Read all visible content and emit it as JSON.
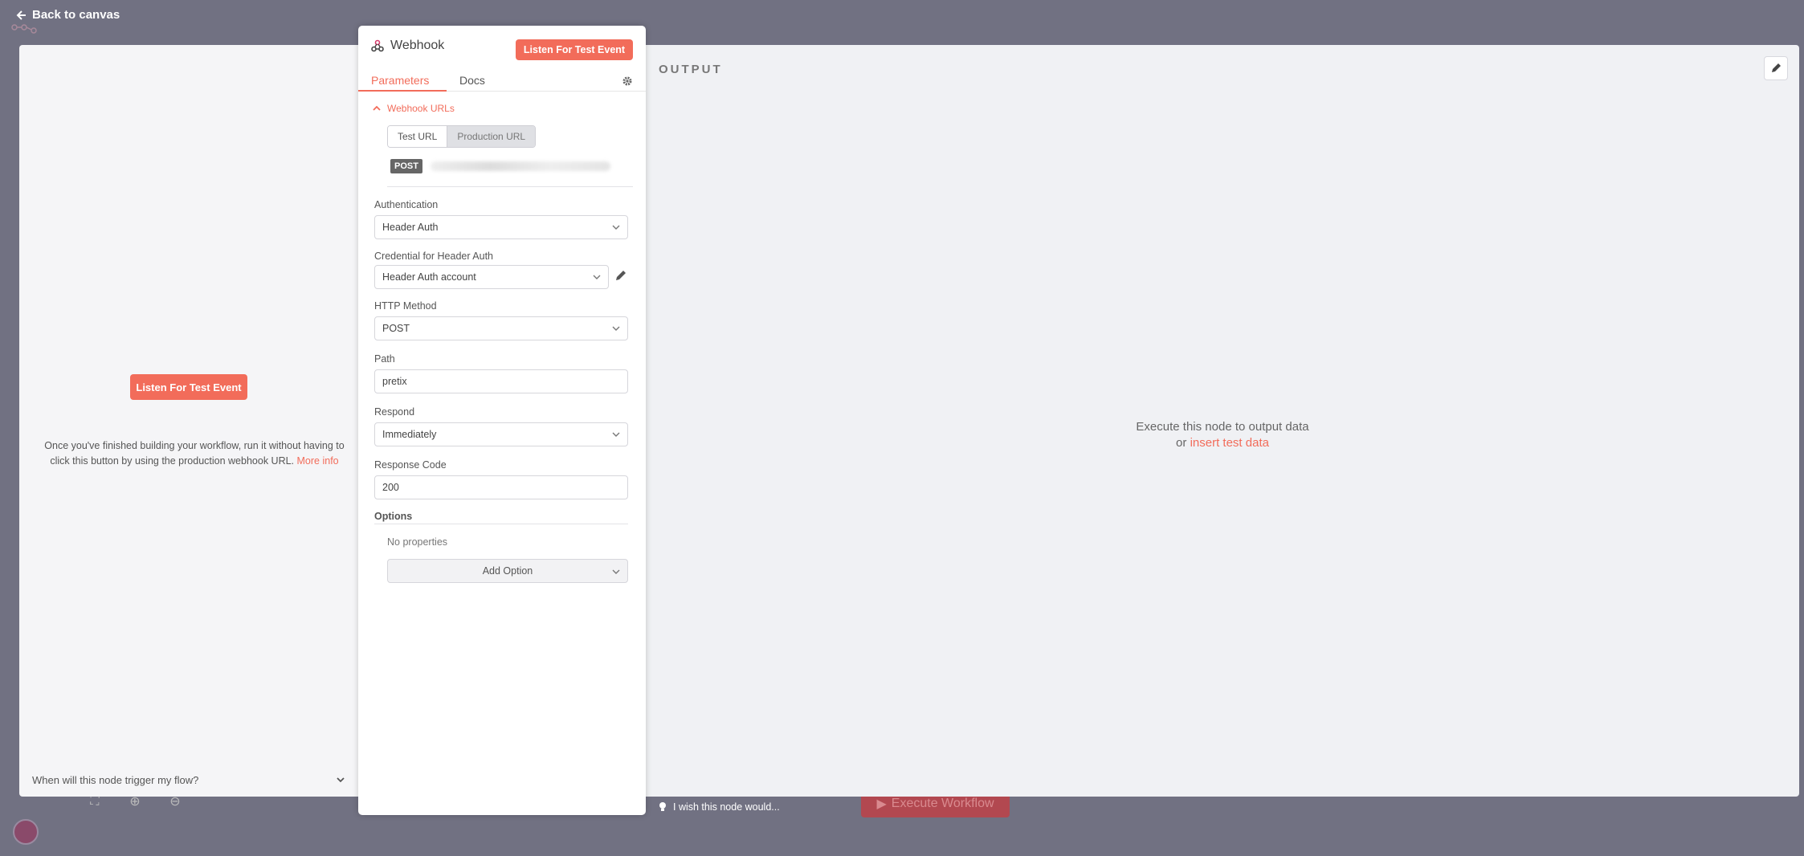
{
  "nav": {
    "back_label": "Back to canvas"
  },
  "node": {
    "title": "Webhook",
    "listen_label": "Listen For Test Event",
    "tabs": [
      "Parameters",
      "Docs"
    ],
    "section_title": "Webhook URLs",
    "url_options": [
      "Test URL",
      "Production URL"
    ],
    "method_badge": "POST",
    "fields": {
      "authentication": {
        "label": "Authentication",
        "value": "Header Auth"
      },
      "credential": {
        "label": "Credential for Header Auth",
        "value": "Header Auth account"
      },
      "http_method": {
        "label": "HTTP Method",
        "value": "POST"
      },
      "path": {
        "label": "Path",
        "value": "pretix"
      },
      "respond": {
        "label": "Respond",
        "value": "Immediately"
      },
      "response_code": {
        "label": "Response Code",
        "value": "200"
      }
    },
    "options": {
      "label": "Options",
      "empty": "No properties",
      "add_label": "Add Option"
    }
  },
  "left_panel": {
    "listen_label": "Listen For Test Event",
    "description": "Once you've finished building your workflow, run it without having to click this button by using the production webhook URL.",
    "more_info": "More info",
    "trigger_question": "When will this node trigger my flow?"
  },
  "output": {
    "title": "OUTPUT",
    "empty_line1": "Execute this node to output data",
    "empty_or": "or",
    "insert_link": "insert test data"
  },
  "footer": {
    "wish_label": "I wish this node would...",
    "execute_label": "Execute Workflow"
  },
  "colors": {
    "accent": "#f26c5a",
    "overlay": "#717182"
  }
}
